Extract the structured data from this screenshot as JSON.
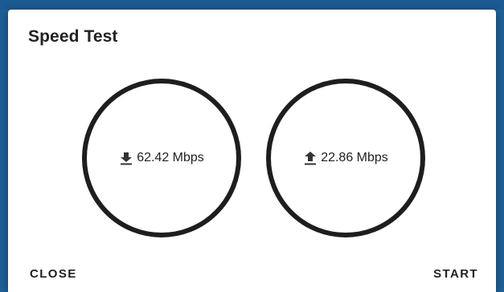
{
  "dialog": {
    "title": "Speed Test",
    "download": {
      "icon": "download-arrow-icon",
      "value": "62.42 Mbps"
    },
    "upload": {
      "icon": "upload-arrow-icon",
      "value": "22.86 Mbps"
    },
    "actions": {
      "close_label": "CLOSE",
      "start_label": "START"
    }
  },
  "colors": {
    "backdrop": "#1f5f96",
    "dialog": "#ffffff",
    "ring": "#1e1e1e",
    "text": "#222222"
  }
}
